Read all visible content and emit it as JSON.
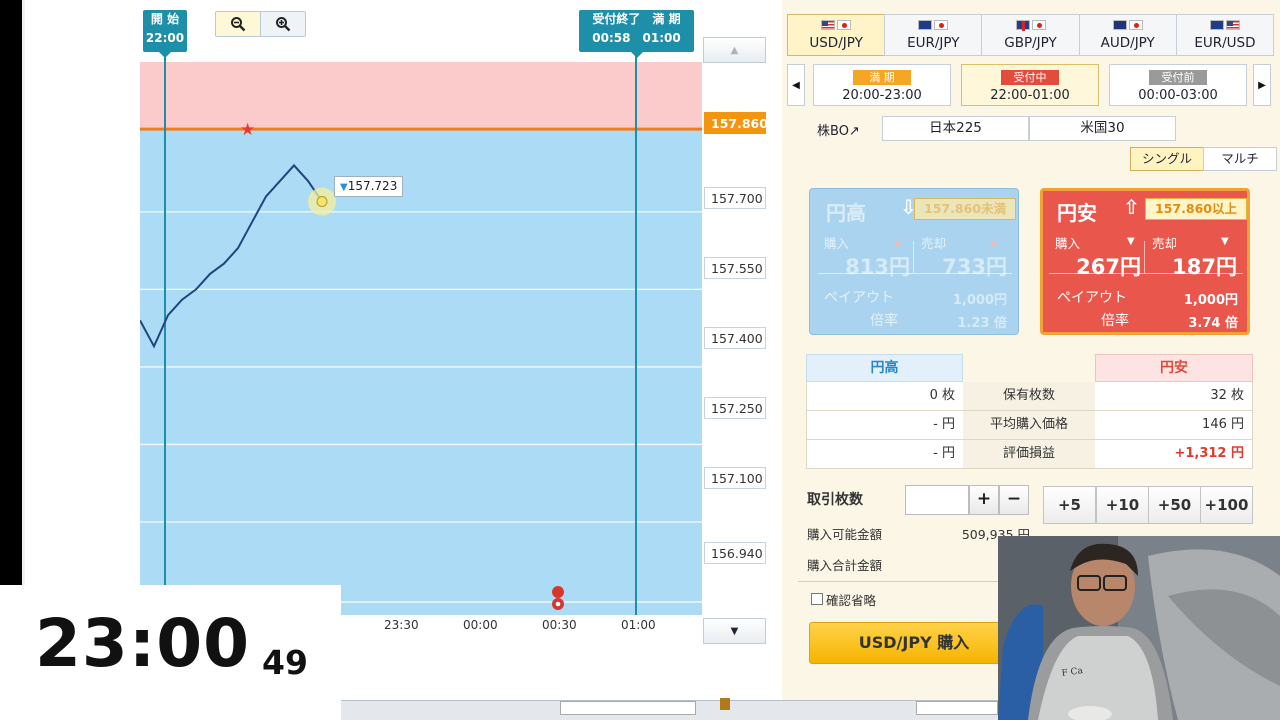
{
  "chart": {
    "start_tag": {
      "title": "開 始",
      "time": "22:00"
    },
    "end_tag": {
      "title": "受付終了　満 期",
      "time": "00:58　01:00"
    },
    "target_price": "157.860",
    "current_price": "157.723",
    "price_axis": [
      "157.700",
      "157.550",
      "157.400",
      "157.250",
      "157.100",
      "156.940"
    ],
    "time_axis": [
      "23:30",
      "00:00",
      "00:30",
      "01:00"
    ],
    "zoom_out_icon": "zoom-out-icon",
    "zoom_in_icon": "zoom-in-icon"
  },
  "chart_data": {
    "type": "line",
    "title": "",
    "xlabel": "",
    "ylabel": "",
    "x": [
      "21:56",
      "22:00",
      "22:05",
      "22:10",
      "22:15",
      "22:20",
      "22:25",
      "22:30",
      "22:35",
      "22:40",
      "22:45",
      "22:50",
      "22:55",
      "22:58"
    ],
    "series": [
      {
        "values": [
          157.49,
          157.44,
          157.5,
          157.53,
          157.55,
          157.58,
          157.6,
          157.63,
          157.68,
          157.73,
          157.76,
          157.79,
          157.76,
          157.72
        ]
      }
    ],
    "target_line": 157.86,
    "ylim": [
      156.92,
      157.99
    ],
    "grid": true
  },
  "currency_tabs": [
    {
      "label": "USD/JPY",
      "active": true
    },
    {
      "label": "EUR/JPY",
      "active": false
    },
    {
      "label": "GBP/JPY",
      "active": false
    },
    {
      "label": "AUD/JPY",
      "active": false
    },
    {
      "label": "EUR/USD",
      "active": false
    }
  ],
  "periods": [
    {
      "badge": "満 期",
      "time": "20:00-23:00",
      "badge_color": "#f5a623"
    },
    {
      "badge": "受付中",
      "time": "22:00-01:00",
      "badge_color": "#e34b3d"
    },
    {
      "badge": "受付前",
      "time": "00:00-03:00",
      "badge_color": "#9a9a9a"
    }
  ],
  "kabu": {
    "label": "株BO↗",
    "buttons": [
      "日本225",
      "米国30"
    ]
  },
  "modes": [
    "シングル",
    "マルチ"
  ],
  "cards": {
    "yen_high": {
      "title": "円高",
      "tag": "157.860未満",
      "buy_label": "購入",
      "sell_label": "売却",
      "buy": "813円",
      "sell": "733円",
      "payout_label": "ペイアウト",
      "payout": "1,000円",
      "rate_label": "倍率",
      "rate": "1.23 倍"
    },
    "yen_low": {
      "title": "円安",
      "tag": "157.860以上",
      "buy_label": "購入",
      "sell_label": "売却",
      "buy": "267円",
      "sell": "187円",
      "payout_label": "ペイアウト",
      "payout": "1,000円",
      "rate_label": "倍率",
      "rate": "3.74 倍"
    }
  },
  "holdings": {
    "head_left": "円高",
    "head_right": "円安",
    "rows": [
      {
        "left": "0 枚",
        "label": "保有枚数",
        "right": "32 枚"
      },
      {
        "left": "- 円",
        "label": "平均購入価格",
        "right": "146 円"
      },
      {
        "left": "- 円",
        "label": "評価損益",
        "right": "+1,312 円"
      }
    ]
  },
  "order": {
    "qty_label": "取引枚数",
    "plus": "+",
    "minus": "−",
    "increments": [
      "+5",
      "+10",
      "+50",
      "+100"
    ],
    "available_label": "購入可能金額",
    "available_value": "509,935 円",
    "total_label": "購入合計金額",
    "confirm_label": "確認省略",
    "buy_button": "USD/JPY 購入"
  },
  "timer": {
    "main": "23:00",
    "sec": "49"
  },
  "colors": {
    "target_line": "#f07d22",
    "price_line": "#23437f",
    "chart_bg": "#acdcf5",
    "chart_zone": "#fbcaca",
    "time_line": "#1d8fa9"
  }
}
